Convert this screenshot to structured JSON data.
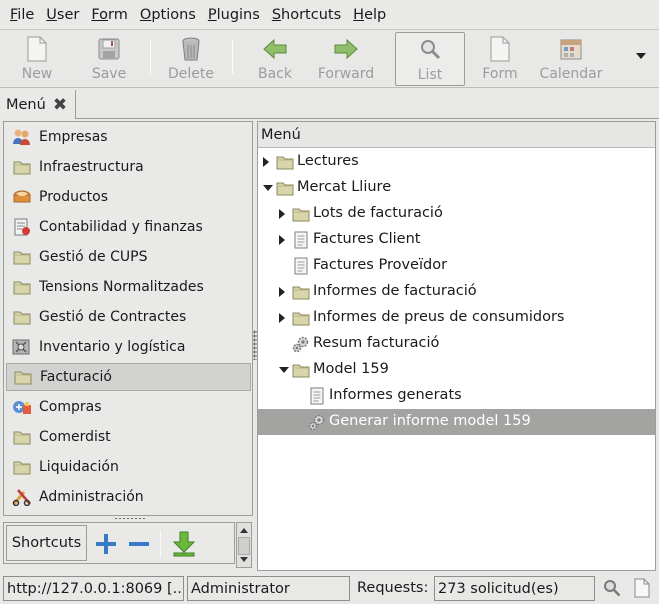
{
  "menubar": {
    "items": [
      {
        "label": "File",
        "mnemonic": "F",
        "rest": "ile"
      },
      {
        "label": "User",
        "mnemonic": "U",
        "rest": "ser"
      },
      {
        "label": "Form",
        "mnemonic": "Fo",
        "rest": "rm"
      },
      {
        "label": "Options",
        "mnemonic": "O",
        "rest": "ptions"
      },
      {
        "label": "Plugins",
        "mnemonic": "P",
        "rest": "lugins"
      },
      {
        "label": "Shortcuts",
        "mnemonic": "S",
        "rest": "hortcuts"
      },
      {
        "label": "Help",
        "mnemonic": "H",
        "rest": "elp"
      }
    ]
  },
  "toolbar": {
    "new_label": "New",
    "save_label": "Save",
    "delete_label": "Delete",
    "back_label": "Back",
    "forward_label": "Forward",
    "list_label": "List",
    "form_label": "Form",
    "calendar_label": "Calendar"
  },
  "tabs": {
    "menu_tab_label": "Menú"
  },
  "sidebar": {
    "items": [
      {
        "label": "Empresas",
        "icon": "partners-icon"
      },
      {
        "label": "Infraestructura",
        "icon": "folder-icon"
      },
      {
        "label": "Productos",
        "icon": "products-icon"
      },
      {
        "label": "Contabilidad y finanzas",
        "icon": "accounting-icon"
      },
      {
        "label": "Gestió de CUPS",
        "icon": "folder-icon"
      },
      {
        "label": "Tensions Normalitzades",
        "icon": "folder-icon"
      },
      {
        "label": "Gestió de Contractes",
        "icon": "folder-icon"
      },
      {
        "label": "Inventario y logística",
        "icon": "stock-icon"
      },
      {
        "label": "Facturació",
        "icon": "folder-icon",
        "selected": true
      },
      {
        "label": "Compras",
        "icon": "purchase-icon"
      },
      {
        "label": "Comerdist",
        "icon": "folder-icon"
      },
      {
        "label": "Liquidación",
        "icon": "folder-icon"
      },
      {
        "label": "Administración",
        "icon": "administration-icon"
      }
    ]
  },
  "shortcuts": {
    "label": "Shortcuts"
  },
  "tree": {
    "header": "Menú",
    "rows": [
      {
        "label": "Lectures",
        "level": 0,
        "expander": "closed",
        "icon": "folder-icon"
      },
      {
        "label": "Mercat Lliure",
        "level": 0,
        "expander": "open",
        "icon": "folder-icon"
      },
      {
        "label": "Lots de facturació",
        "level": 1,
        "expander": "closed",
        "icon": "folder-icon"
      },
      {
        "label": "Factures Client",
        "level": 1,
        "expander": "closed",
        "icon": "document-icon"
      },
      {
        "label": "Factures Proveïdor",
        "level": 1,
        "expander": "none",
        "icon": "document-icon"
      },
      {
        "label": "Informes de facturació",
        "level": 1,
        "expander": "closed",
        "icon": "folder-icon"
      },
      {
        "label": "Informes de preus de consumidors",
        "level": 1,
        "expander": "closed",
        "icon": "folder-icon"
      },
      {
        "label": "Resum facturació",
        "level": 1,
        "expander": "none",
        "icon": "gears-icon"
      },
      {
        "label": "Model 159",
        "level": 1,
        "expander": "open",
        "icon": "folder-icon"
      },
      {
        "label": "Informes generats",
        "level": 2,
        "expander": "none",
        "icon": "document-icon"
      },
      {
        "label": "Generar informe model 159",
        "level": 2,
        "expander": "none",
        "icon": "gears-icon",
        "selected": true
      }
    ]
  },
  "statusbar": {
    "server": "http://127.0.0.1:8069 [...",
    "user": "Administrator",
    "requests_label": "Requests:",
    "requests_value": "273 solicitud(es)"
  },
  "colors": {
    "selection": "#a3a3a1",
    "folder": "#d6d3a8",
    "arrow_green": "#6ea844",
    "shortcut_blue": "#3a78c8"
  }
}
